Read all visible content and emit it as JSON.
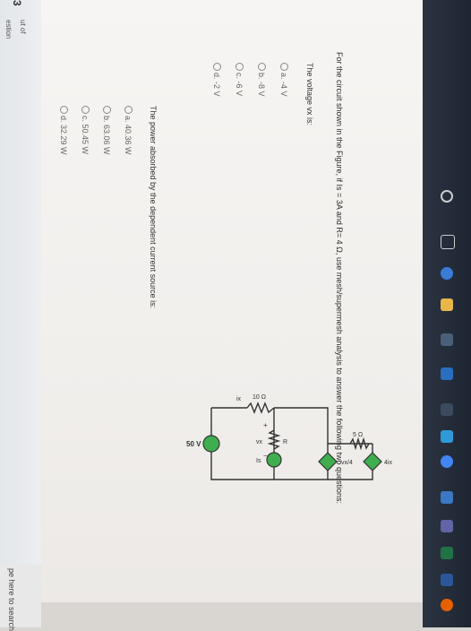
{
  "sidebar": {
    "question_number": "3",
    "out_of_text": "ut of",
    "question_label": "estion"
  },
  "question": {
    "prompt": "For the circuit shown in the Figure, if Is = 3A and R= 4 Ω, use mesh/supermesh analysis to answer the following two questions:",
    "q1": {
      "label": "The voltage vx is:",
      "options": [
        "a. -4 V",
        "b. -8 V",
        "c. -6 V",
        "d. -2 V"
      ]
    },
    "q2": {
      "label": "The power absorbed by the dependent current source is:",
      "options": [
        "a. 40.36 W",
        "b. 63.06 W",
        "c. 50.45 W",
        "d. 32.29 W"
      ]
    }
  },
  "circuit": {
    "r10": "10 Ω",
    "r5": "5 Ω",
    "src50": "50 V",
    "is_label": "Is",
    "ix_label": "ix",
    "vx_label": "vx",
    "r_label": "R",
    "dep_v_label": "vx/4",
    "dep_i_label": "4ix",
    "plus": "+",
    "minus": "−"
  },
  "taskbar": {
    "search_placeholder": "pe here to search"
  }
}
